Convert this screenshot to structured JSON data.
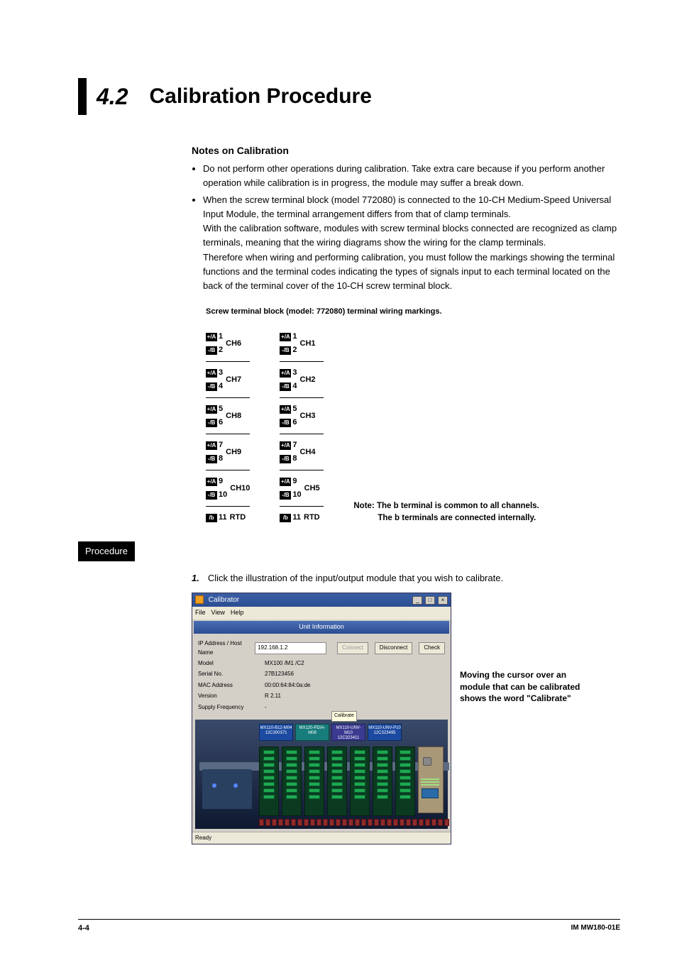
{
  "heading": {
    "number": "4.2",
    "title": "Calibration Procedure"
  },
  "notes": {
    "heading": "Notes on Calibration",
    "bullet1": "Do not perform other operations during calibration. Take extra care because if you perform another operation while calibration is in progress, the module may suffer a break down.",
    "bullet2_p1": "When the screw terminal block (model 772080) is connected to the 10-CH Medium-Speed Universal Input Module, the terminal arrangement differs from that of clamp terminals.",
    "bullet2_p2": "With the calibration software, modules with screw terminal blocks connected are recognized as clamp terminals, meaning that the wiring diagrams show the wiring for the clamp terminals.",
    "bullet2_p3": "Therefore when wiring and performing calibration, you must follow the markings showing the terminal functions and the terminal codes indicating the types of signals input to each terminal located on the back of the terminal cover of the 10-CH screw terminal block."
  },
  "diagram": {
    "caption": "Screw terminal block (model: 772080) terminal wiring markings.",
    "note_line1": "Note: The b terminal is common to all channels.",
    "note_line2": "The b terminals are connected internally.",
    "left": [
      {
        "a": "1",
        "b": "2",
        "ch": "CH6"
      },
      {
        "a": "3",
        "b": "4",
        "ch": "CH7"
      },
      {
        "a": "5",
        "b": "6",
        "ch": "CH8"
      },
      {
        "a": "7",
        "b": "8",
        "ch": "CH9"
      },
      {
        "a": "9",
        "b": "10",
        "ch": "CH10"
      }
    ],
    "left_rtd": {
      "n": "11",
      "label": "RTD"
    },
    "right": [
      {
        "a": "1",
        "b": "2",
        "ch": "CH1"
      },
      {
        "a": "3",
        "b": "4",
        "ch": "CH2"
      },
      {
        "a": "5",
        "b": "6",
        "ch": "CH3"
      },
      {
        "a": "7",
        "b": "8",
        "ch": "CH4"
      },
      {
        "a": "9",
        "b": "10",
        "ch": "CH5"
      }
    ],
    "right_rtd": {
      "n": "11",
      "label": "RTD"
    },
    "sub_a": "+/A",
    "sub_b": "-/B",
    "sub_rtd": "/b"
  },
  "procedure": {
    "label": "Procedure",
    "step1_num": "1.",
    "step1_text": "Click the illustration of the input/output module that you wish to calibrate."
  },
  "screenshot": {
    "title": "Calibrator",
    "menu": {
      "file": "File",
      "view": "View",
      "help": "Help"
    },
    "unit_info": "Unit Information",
    "rows": {
      "ip_label": "IP Address / Host Name",
      "ip_value": "192.168.1.2",
      "model_label": "Model",
      "model_value": "MX100 /M1 /C2",
      "serial_label": "Serial No.",
      "serial_value": "27B123456",
      "mac_label": "MAC Address",
      "mac_value": "00:00:64:84:0a:de",
      "version_label": "Version",
      "version_value": "R 2.11",
      "supply_label": "Supply Frequency",
      "supply_value": "-"
    },
    "buttons": {
      "connect": "Connect",
      "disconnect": "Disconnect",
      "check": "Check"
    },
    "callout": "Calibrate",
    "modules": {
      "m0": {
        "l1": "MX110-B12-M04",
        "l2": "12C300371"
      },
      "m1": {
        "l1": "MX120-PD/A-M08",
        "l2": ""
      },
      "m2": {
        "l1": "MX110-UNV-M10",
        "l2": "12C323411"
      },
      "m3": {
        "l1": "MX110-UNV-P10",
        "l2": "12C323495"
      }
    },
    "status": "Ready"
  },
  "side_note": "Moving the cursor over an module that can be calibrated shows the word \"Calibrate\"",
  "footer": {
    "page": "4-4",
    "doc": "IM MW180-01E"
  }
}
